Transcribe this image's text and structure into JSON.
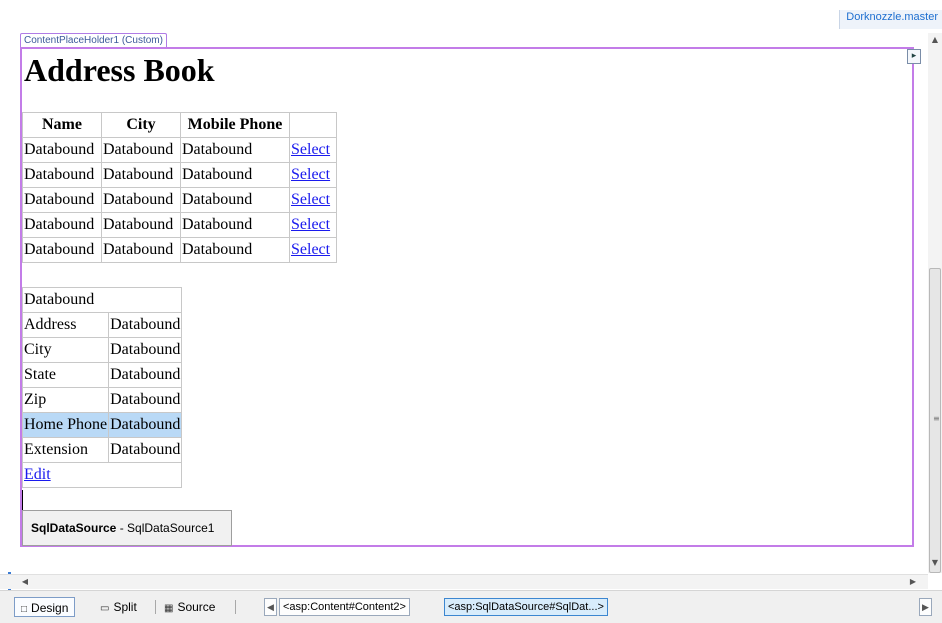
{
  "master_file": "Dorknozzle.master",
  "placeholder_label": "ContentPlaceHolder1 (Custom)",
  "heading": "Address Book",
  "grid": {
    "headers": [
      "Name",
      "City",
      "Mobile Phone",
      ""
    ],
    "rows": [
      [
        "Databound",
        "Databound",
        "Databound",
        "Select"
      ],
      [
        "Databound",
        "Databound",
        "Databound",
        "Select"
      ],
      [
        "Databound",
        "Databound",
        "Databound",
        "Select"
      ],
      [
        "Databound",
        "Databound",
        "Databound",
        "Select"
      ],
      [
        "Databound",
        "Databound",
        "Databound",
        "Select"
      ]
    ]
  },
  "details": {
    "header": "Databound",
    "rows": [
      {
        "label": "Address",
        "value": "Databound"
      },
      {
        "label": "City",
        "value": "Databound"
      },
      {
        "label": "State",
        "value": "Databound"
      },
      {
        "label": "Zip",
        "value": "Databound"
      },
      {
        "label": "Home Phone",
        "value": "Databound"
      },
      {
        "label": "Extension",
        "value": "Databound"
      }
    ],
    "selected_row": "Home Phone",
    "edit_link": "Edit"
  },
  "sqldatasource": {
    "type": "SqlDataSource",
    "separator": " - ",
    "id": "SqlDataSource1"
  },
  "bottombar": {
    "views": [
      "Design",
      "Split",
      "Source"
    ],
    "active_view": "Design",
    "tags": [
      "<asp:Content#Content2>",
      "<asp:SqlDataSource#SqlDat...>"
    ]
  },
  "icons": {
    "design": "design-view-icon",
    "split": "split-view-icon",
    "source": "source-view-icon"
  },
  "colors": {
    "placeholder_border": "#c37ce8",
    "link": "#1a1aee",
    "selected_row": "#b9d9f6",
    "active_tag": "#d8ecfb"
  }
}
